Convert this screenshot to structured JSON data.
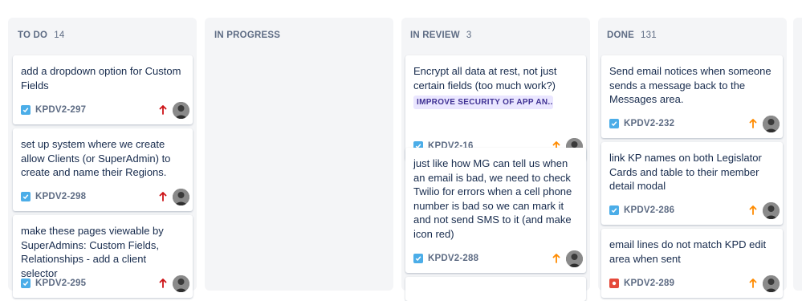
{
  "columns": [
    {
      "title": "TO DO",
      "count": "14",
      "cards": [
        {
          "title": "add a dropdown option for Custom Fields",
          "key": "KPDV2-297",
          "type": "task-icon",
          "priority": "high"
        },
        {
          "title": "set up system where we create allow Clients (or SuperAdmin) to create and name their Regions.",
          "key": "KPDV2-298",
          "type": "task-icon",
          "priority": "high"
        },
        {
          "title": "make these pages viewable by SuperAdmins: Custom Fields, Relationships - add a client selector",
          "key": "KPDV2-295",
          "type": "task-icon",
          "priority": "high"
        }
      ]
    },
    {
      "title": "IN PROGRESS",
      "count": "",
      "cards": []
    },
    {
      "title": "IN REVIEW",
      "count": "3",
      "cards": [
        {
          "title": "Encrypt all data at rest, not just certain fields (too much work?)",
          "epic": "IMPROVE SECURITY OF APP AN...",
          "key": "KPDV2-16",
          "type": "task-icon",
          "priority": "medium"
        },
        {
          "title": "just like how MG can tell us when an email is bad, we need to check Twilio for errors when a cell phone number is bad so we can mark it and not send SMS to it (and make icon red)",
          "key": "KPDV2-288",
          "type": "task-icon",
          "priority": "medium"
        }
      ]
    },
    {
      "title": "DONE",
      "count": "131",
      "cards": [
        {
          "title": "Send email notices when someone sends a message back to the Messages area.",
          "key": "KPDV2-232",
          "type": "task-icon",
          "priority": "medium"
        },
        {
          "title": "link KP names on both Legislator Cards and table to their member detail modal",
          "key": "KPDV2-286",
          "type": "task-icon",
          "priority": "medium"
        },
        {
          "title": "email lines do not match KPD edit area when sent",
          "key": "KPDV2-289",
          "type": "bug-icon",
          "priority": "medium"
        }
      ]
    }
  ],
  "colors": {
    "column_bg": "#f4f5f7",
    "priority_high": "#cd1317",
    "priority_medium": "#ff8b00",
    "task": "#4bade8",
    "bug": "#e5493a",
    "epic_bg": "#eae6ff",
    "epic_text": "#403294"
  }
}
